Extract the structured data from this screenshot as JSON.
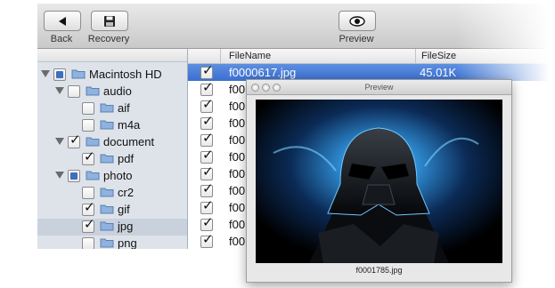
{
  "toolbar": {
    "back_label": "Back",
    "recovery_label": "Recovery",
    "preview_label": "Preview"
  },
  "tree": {
    "items": [
      {
        "label": "Macintosh HD",
        "state": "mixed"
      },
      {
        "label": "audio",
        "state": "unchecked"
      },
      {
        "label": "aif",
        "state": "unchecked"
      },
      {
        "label": "m4a",
        "state": "unchecked"
      },
      {
        "label": "document",
        "state": "checked"
      },
      {
        "label": "pdf",
        "state": "checked"
      },
      {
        "label": "photo",
        "state": "mixed"
      },
      {
        "label": "cr2",
        "state": "unchecked"
      },
      {
        "label": "gif",
        "state": "checked"
      },
      {
        "label": "jpg",
        "state": "checked"
      },
      {
        "label": "png",
        "state": "unchecked"
      }
    ]
  },
  "list": {
    "columns": [
      "FileName",
      "FileSize"
    ],
    "rows": [
      {
        "name": "f0000617.jpg",
        "size": "45.01K",
        "checked": true
      },
      {
        "name": "f00",
        "size": "",
        "checked": true
      },
      {
        "name": "f00",
        "size": "",
        "checked": true
      },
      {
        "name": "f00",
        "size": "",
        "checked": true
      },
      {
        "name": "f00",
        "size": "",
        "checked": true
      },
      {
        "name": "f00",
        "size": "",
        "checked": true
      },
      {
        "name": "f00",
        "size": "",
        "checked": true
      },
      {
        "name": "f00",
        "size": "",
        "checked": true
      },
      {
        "name": "f00",
        "size": "",
        "checked": true
      },
      {
        "name": "f00",
        "size": "",
        "checked": true
      },
      {
        "name": "f00",
        "size": "",
        "checked": true
      }
    ]
  },
  "preview_window": {
    "title": "Preview",
    "caption": "f0001785.jpg"
  },
  "colors": {
    "selection": "#3c6fd0",
    "sidebar_bg": "#dee3ea",
    "mixed_check": "#3d6fc2"
  }
}
